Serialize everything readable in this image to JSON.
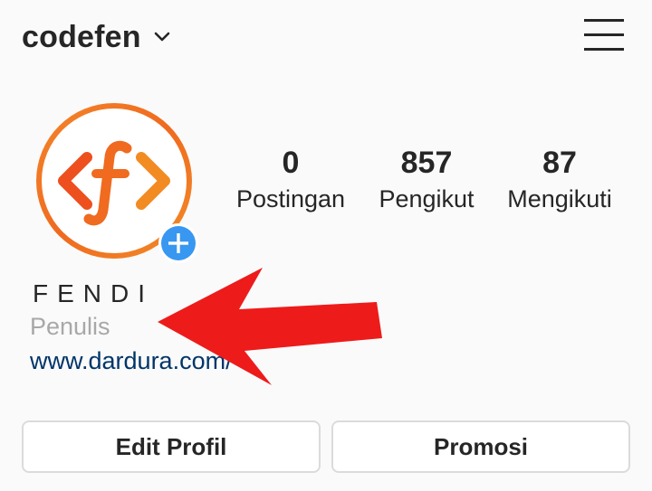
{
  "header": {
    "username": "codefen",
    "dropdown_icon": "chevron-down-icon",
    "menu_icon": "hamburger-menu-icon"
  },
  "profile": {
    "avatar_text": "<f>",
    "add_icon": "plus-icon",
    "stats": [
      {
        "value": "0",
        "label": "Postingan"
      },
      {
        "value": "857",
        "label": "Pengikut"
      },
      {
        "value": "87",
        "label": "Mengikuti"
      }
    ],
    "name": "FENDI",
    "category": "Penulis",
    "website": "www.dardura.com/"
  },
  "annotation": {
    "arrow_icon": "red-arrow-left-icon",
    "color": "#ee1b1b"
  },
  "actions": {
    "edit_label": "Edit Profil",
    "promo_label": "Promosi"
  },
  "colors": {
    "background": "#fafafa",
    "text": "#262626",
    "muted": "#a8a8a8",
    "link": "#003569",
    "accent_blue": "#3897f0",
    "logo_orange": "#f26b1d"
  }
}
